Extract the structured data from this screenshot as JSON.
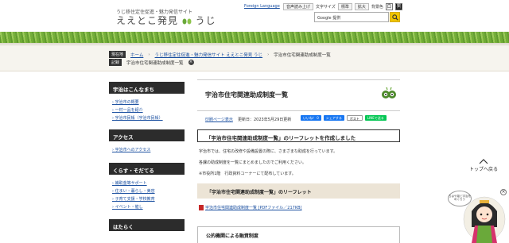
{
  "header": {
    "site_subtitle": "うじ移住定住促進・魅力発信サイト",
    "site_title": "ええとこ発見",
    "site_title_suffix": "うじ",
    "foreign_language": "Foreign Language",
    "read_aloud": "音声読み上げ",
    "text_size_label": "文字サイズ",
    "text_size_standard": "標準",
    "text_size_large": "拡大",
    "contrast_label": "背景色",
    "contrast_white": "白",
    "contrast_black": "黒",
    "search_placeholder": "Google 提供"
  },
  "breadcrumb": {
    "current_tag": "現在地",
    "items": [
      "ホーム",
      "うじ移住定住促進・魅力発信サイト ええとこ発見 うじ",
      "宇治市住宅関連助成制度一覧"
    ],
    "history_tag": "記録",
    "history_item": "宇治市住宅関連助成制度一覧"
  },
  "sidebar": {
    "sections": [
      {
        "title": "宇治はこんなまち",
        "items": [
          "宇治市の概要",
          "一村一品を紹介",
          "宇治市民帳（宇治市民帳）"
        ]
      },
      {
        "title": "アクセス",
        "items": [
          "宇治市へのアクセス"
        ]
      },
      {
        "title": "くらす・そだてる",
        "items": [
          "補助金等サポート",
          "住まい・暮らし・美容",
          "子育て支援・学校教育",
          "イベント・催し"
        ]
      },
      {
        "title": "はたらく",
        "items": []
      }
    ]
  },
  "main": {
    "title": "宇治市住宅関連助成制度一覧",
    "print_link": "印刷ページ表示",
    "updated": "更新日：2023年5月29日更新",
    "sns": {
      "fb": "いいね！ 0",
      "share": "シェアする",
      "x": "ポスト",
      "line": "LINEで送る"
    },
    "lead_heading": "「宇治市住宅関連助成制度一覧」のリーフレットを作成しました",
    "paragraphs": [
      "宇治市では、住宅の改修や設備設置の際に、さまざまな助成を行っています。",
      "各課の助成制度を一覧にまとめましたのでご利用ください。",
      "※市役所1階　行政資料コーナーにて配布しています。"
    ],
    "section_heading": "「宇治市住宅関連助成制度一覧」のリーフレット",
    "pdf_link": "宇治市住宅関連助成制度一覧 [PDFファイル／217KB]",
    "section2_heading": "公的機関による融資制度"
  },
  "to_top": "トップへ戻る",
  "mascot_bubble": "ちはや姫と宇治をめぐろう",
  "colors": {
    "accent_link": "#1a4fa0",
    "sidebar_head": "#2c2c2c",
    "section_bg": "#ece4d6",
    "search_btn": "#f0c400"
  }
}
